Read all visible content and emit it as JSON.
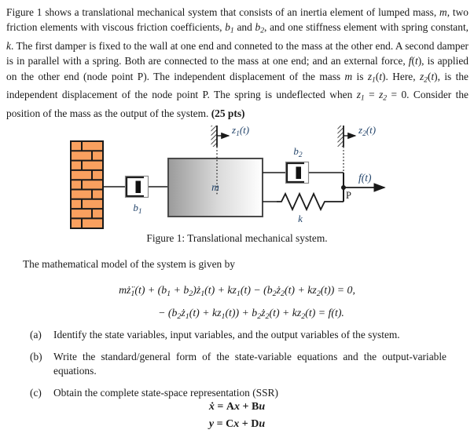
{
  "document": {
    "problem_statement": "Figure 1 shows a translational mechanical system that consists of an inertia element of lumped mass, m, two friction elements with viscous friction coefficients, b1 and b2, and one stiffness element with spring constant, k. The first damper is fixed to the wall at one end and conneted to the mass at the other end. A second damper is in parallel with a spring. Both are connected to the mass at one end; and an external force, f(t), is applied on the other end (node point P). The independent displacement of the mass m is z1(t). Here, z2(t), is the independent displacement of the node point P. The spring is undeflected when z1 = z2 = 0. Consider the position of the mass as the output of the system. (25 pts)",
    "points_label": "(25 pts)",
    "figure_caption": "Figure 1: Translational mechanical system.",
    "math_model_intro": "The mathematical model of the system is given by",
    "equation_line_1": "m z̈₁(t) + (b₁ + b₂) ż₁(t) + k z₁(t) − (b₂ ż₂(t) + k z₂(t)) = 0,",
    "equation_line_2": "− (b₂ ż₁(t) + k z₁(t)) + b₂ ż₂(t) + k z₂(t) = f(t).",
    "items": [
      {
        "marker": "(a)",
        "text": "Identify the state variables, input variables, and the output variables of the system."
      },
      {
        "marker": "(b)",
        "text": "Write the standard/general form of the state-variable equations and the output-variable equations."
      },
      {
        "marker": "(c)",
        "text": "Obtain the complete state-space representation (SSR)"
      }
    ],
    "ssr": {
      "line_1": "ẋ = Ax + Bu",
      "line_2": "y = Cx + Du"
    }
  },
  "figure": {
    "labels": {
      "mass": "m",
      "damper_1": "b₁",
      "damper_2": "b₂",
      "spring": "k",
      "displacement_1": "z₁(t)",
      "displacement_2": "z₂(t)",
      "force": "f(t)",
      "node_point": "P"
    },
    "colors": {
      "brick_fill": "#f9a05f",
      "brick_mortar": "#1a1a1a",
      "mass_gradient_start": "#9a9a9a",
      "mass_gradient_end": "#ffffff",
      "outline": "#1a1a1a",
      "label_text": "#24456b"
    }
  }
}
